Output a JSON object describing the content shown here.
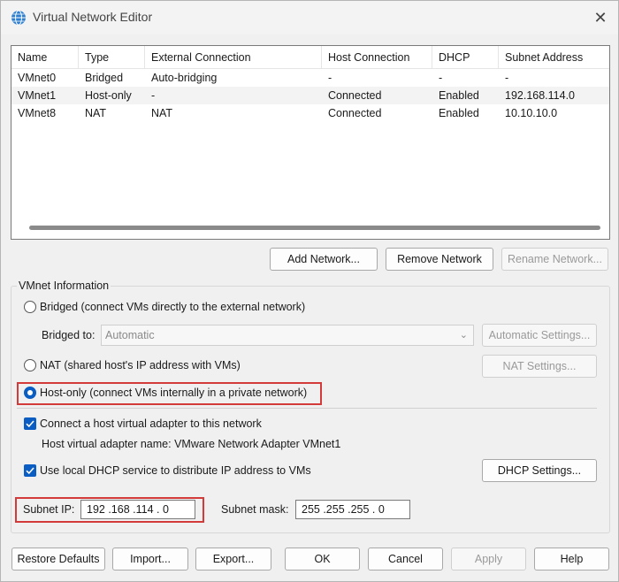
{
  "window": {
    "title": "Virtual Network Editor"
  },
  "table": {
    "columns": [
      "Name",
      "Type",
      "External Connection",
      "Host Connection",
      "DHCP",
      "Subnet Address"
    ],
    "rows": [
      [
        "VMnet0",
        "Bridged",
        "Auto-bridging",
        "-",
        "-",
        "-"
      ],
      [
        "VMnet1",
        "Host-only",
        "-",
        "Connected",
        "Enabled",
        "192.168.114.0"
      ],
      [
        "VMnet8",
        "NAT",
        "NAT",
        "Connected",
        "Enabled",
        "10.10.10.0"
      ]
    ]
  },
  "network_buttons": {
    "add": "Add Network...",
    "remove": "Remove Network",
    "rename": "Rename Network..."
  },
  "vmnet_info": {
    "group_label": "VMnet Information",
    "bridged_label": "Bridged (connect VMs directly to the external network)",
    "bridged_to_label": "Bridged to:",
    "bridged_to_value": "Automatic",
    "automatic_settings": "Automatic Settings...",
    "nat_label": "NAT (shared host's IP address with VMs)",
    "nat_settings": "NAT Settings...",
    "hostonly_label": "Host-only (connect VMs internally in a private network)",
    "selected_mode": "host-only",
    "connect_adapter_label": "Connect a host virtual adapter to this network",
    "adapter_name_text": "Host virtual adapter name: VMware Network Adapter VMnet1",
    "dhcp_label": "Use local DHCP service to distribute IP address to VMs",
    "dhcp_settings": "DHCP Settings...",
    "subnet_ip_label": "Subnet IP:",
    "subnet_ip_value": "192 .168 .114 .  0",
    "subnet_mask_label": "Subnet mask:",
    "subnet_mask_value": "255 .255 .255 .  0"
  },
  "footer": {
    "restore": "Restore Defaults",
    "import": "Import...",
    "export": "Export...",
    "ok": "OK",
    "cancel": "Cancel",
    "apply": "Apply",
    "help": "Help"
  },
  "colors": {
    "accent": "#0a5dc2",
    "highlight": "#d33a3a"
  }
}
